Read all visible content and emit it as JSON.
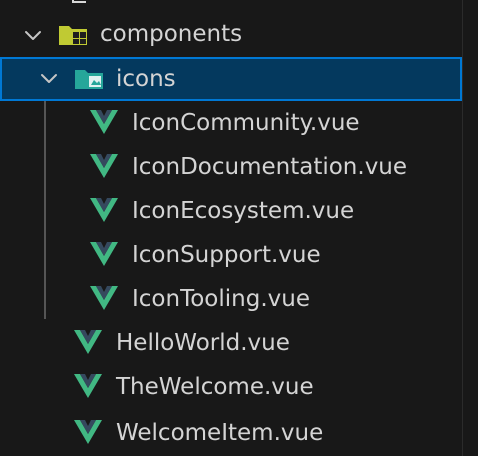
{
  "explorer": {
    "top_partial_label": "public",
    "components_folder": {
      "label": "components",
      "icon": "folder-components-icon",
      "expanded": true
    },
    "icons_folder": {
      "label": "icons",
      "icon": "folder-icons-icon",
      "expanded": true,
      "selected": true
    },
    "icon_files": [
      {
        "label": "IconCommunity.vue",
        "icon": "vue-icon"
      },
      {
        "label": "IconDocumentation.vue",
        "icon": "vue-icon"
      },
      {
        "label": "IconEcosystem.vue",
        "icon": "vue-icon"
      },
      {
        "label": "IconSupport.vue",
        "icon": "vue-icon"
      },
      {
        "label": "IconTooling.vue",
        "icon": "vue-icon"
      }
    ],
    "component_files": [
      {
        "label": "HelloWorld.vue",
        "icon": "vue-icon"
      },
      {
        "label": "TheWelcome.vue",
        "icon": "vue-icon"
      },
      {
        "label": "WelcomeItem.vue",
        "icon": "vue-icon"
      }
    ]
  },
  "colors": {
    "background": "#181818",
    "selection_background": "#04395e",
    "selection_border": "#0078d4",
    "vue_green": "#41b883",
    "vue_dark": "#35495e",
    "text": "#d4d4d4"
  }
}
